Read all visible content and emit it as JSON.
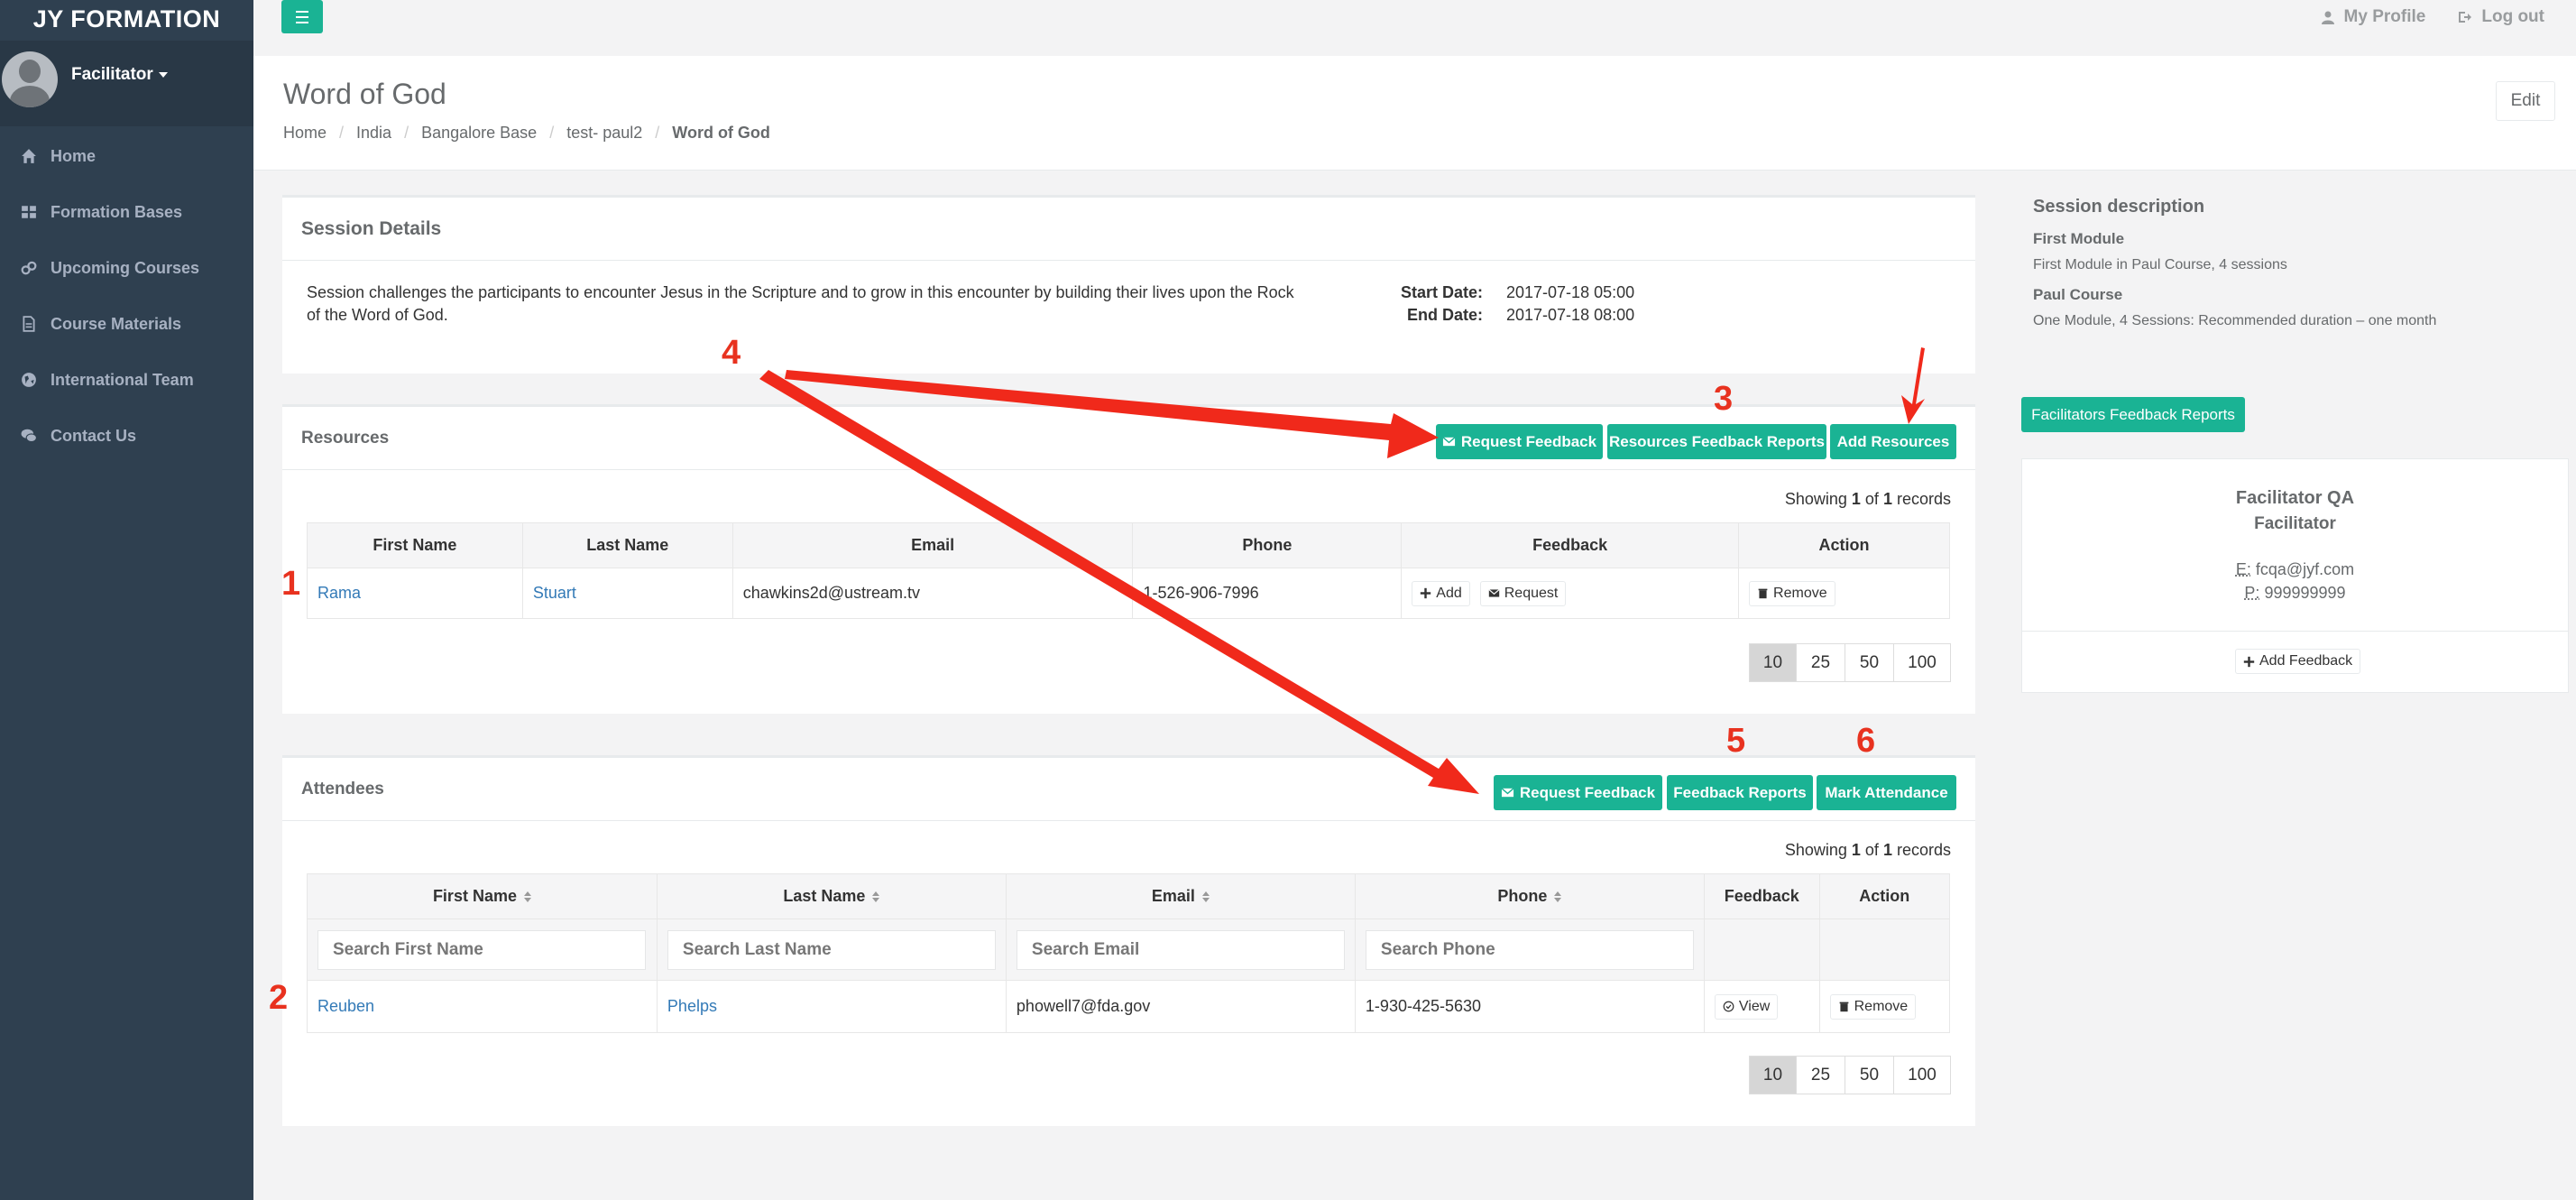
{
  "sidebar": {
    "brand": "JY FORMATION",
    "user": "Facilitator",
    "nav": [
      {
        "label": "Home",
        "icon": "home-icon"
      },
      {
        "label": "Formation Bases",
        "icon": "grid-icon"
      },
      {
        "label": "Upcoming Courses",
        "icon": "link-icon"
      },
      {
        "label": "Course Materials",
        "icon": "file-icon"
      },
      {
        "label": "International Team",
        "icon": "globe-icon"
      },
      {
        "label": "Contact Us",
        "icon": "comments-icon"
      }
    ]
  },
  "topbar": {
    "profile_label": "My Profile",
    "logout_label": "Log out"
  },
  "heading": {
    "title": "Word of God",
    "breadcrumb": [
      "Home",
      "India",
      "Bangalore Base",
      "test- paul2",
      "Word of God"
    ],
    "edit_label": "Edit"
  },
  "session": {
    "title": "Session Details",
    "description": "Session challenges the participants to encounter Jesus in the Scripture and to grow in this encounter by building their lives upon the Rock of the Word of God.",
    "start_label": "Start Date:",
    "start_value": "2017-07-18 05:00",
    "end_label": "End Date:",
    "end_value": "2017-07-18 08:00"
  },
  "resources": {
    "title": "Resources",
    "buttons": {
      "request_feedback": "Request Feedback",
      "feedback_reports": "Resources Feedback Reports",
      "add_resources": "Add Resources"
    },
    "showing": {
      "prefix": "Showing",
      "from": "1",
      "of": "of",
      "total": "1",
      "suffix": "records"
    },
    "columns": [
      "First Name",
      "Last Name",
      "Email",
      "Phone",
      "Feedback",
      "Action"
    ],
    "rows": [
      {
        "first": "Rama",
        "last": "Stuart",
        "email": "chawkins2d@ustream.tv",
        "phone": "1-526-906-7996",
        "add": "Add",
        "request": "Request",
        "remove": "Remove"
      }
    ],
    "pages": [
      "10",
      "25",
      "50",
      "100"
    ]
  },
  "attendees": {
    "title": "Attendees",
    "buttons": {
      "request_feedback": "Request Feedback",
      "feedback_reports": "Feedback Reports",
      "mark_attendance": "Mark Attendance"
    },
    "showing": {
      "prefix": "Showing",
      "from": "1",
      "of": "of",
      "total": "1",
      "suffix": "records"
    },
    "columns": [
      "First Name",
      "Last Name",
      "Email",
      "Phone",
      "Feedback",
      "Action"
    ],
    "search": {
      "first": "Search First Name",
      "last": "Search Last Name",
      "email": "Search Email",
      "phone": "Search Phone"
    },
    "rows": [
      {
        "first": "Reuben",
        "last": "Phelps",
        "email": "phowell7@fda.gov",
        "phone": "1-930-425-5630",
        "view": "View",
        "remove": "Remove"
      }
    ],
    "pages": [
      "10",
      "25",
      "50",
      "100"
    ]
  },
  "right": {
    "desc_title": "Session description",
    "module_title": "First Module",
    "module_text": "First Module in Paul Course, 4 sessions",
    "course_title": "Paul Course",
    "course_text": "One Module, 4 Sessions: Recommended duration – one month",
    "fac_reports_label": "Facilitators Feedback Reports",
    "fac_name": "Facilitator QA",
    "fac_role": "Facilitator",
    "email_label": "E:",
    "email": "fcqa@jyf.com",
    "phone_label": "P:",
    "phone": "999999999",
    "add_feedback_label": "Add Feedback"
  },
  "annotations": [
    "1",
    "2",
    "3",
    "4",
    "5",
    "6"
  ],
  "colors": {
    "accent": "#1ab394",
    "sidebar": "#2f4050",
    "annotation": "#e8321f",
    "link": "#337ab7"
  }
}
